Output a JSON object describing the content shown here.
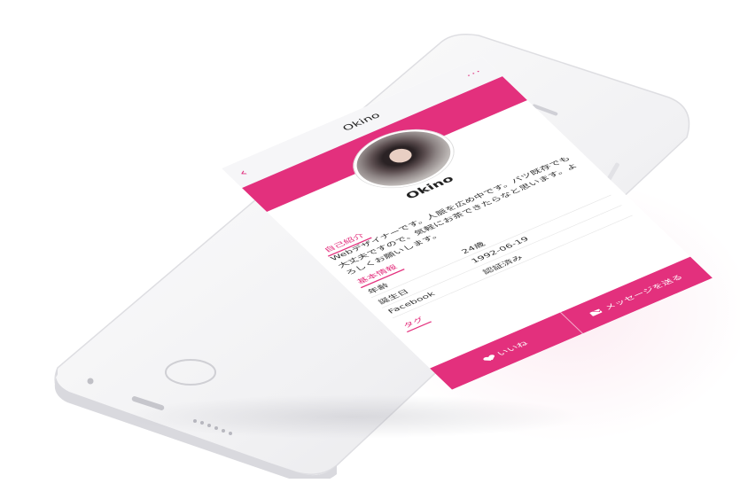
{
  "app": {
    "title": "Okino"
  },
  "nav": {
    "back_icon": "‹",
    "more_icon": "···"
  },
  "profile": {
    "name": "Okino"
  },
  "sections": {
    "intro_label": "自己紹介",
    "intro_text": "Webデザイナーです。人脈を広め中です。バツ既存でも大丈夫ですので、気軽にお茶できたらなと思います。よろしくお願いします。",
    "basic_label": "基本情報",
    "tags_label": "タグ"
  },
  "basic_info": [
    {
      "key": "年齢",
      "value": "24歳"
    },
    {
      "key": "誕生日",
      "value": "1992-06-19"
    },
    {
      "key": "Facebook",
      "value": "認証済み"
    }
  ],
  "actions": {
    "like_label": "いいね",
    "message_label": "メッセージを送る"
  },
  "colors": {
    "accent": "#e3307d",
    "device": "#f2f2f4"
  }
}
